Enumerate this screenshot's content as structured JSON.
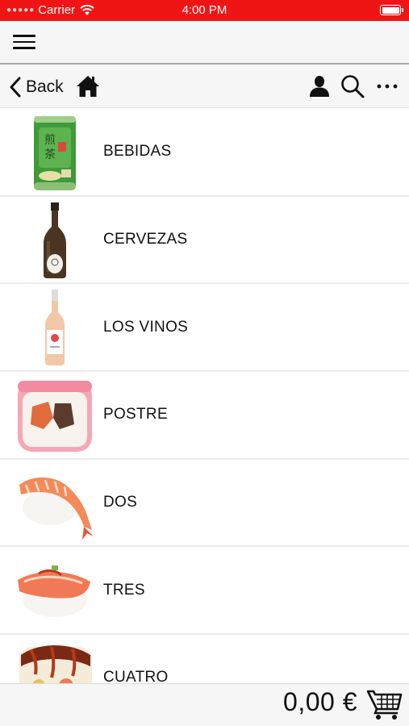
{
  "status_bar": {
    "carrier": "Carrier",
    "time": "4:00 PM",
    "color": "#f01515"
  },
  "nav": {
    "back_label": "Back",
    "icons": [
      "home-icon",
      "user-icon",
      "search-icon",
      "more-icon"
    ]
  },
  "categories": [
    {
      "label": "BEBIDAS",
      "image": "green-tea-can"
    },
    {
      "label": "CERVEZAS",
      "image": "beer-bottle"
    },
    {
      "label": "LOS VINOS",
      "image": "rose-wine-bottle"
    },
    {
      "label": "POSTRE",
      "image": "pink-sushi-roll"
    },
    {
      "label": "DOS",
      "image": "shrimp-nigiri"
    },
    {
      "label": "TRES",
      "image": "salmon-nigiri"
    },
    {
      "label": "CUATRO",
      "image": "sushi-rolls"
    }
  ],
  "cart": {
    "total": "0,00 €"
  }
}
